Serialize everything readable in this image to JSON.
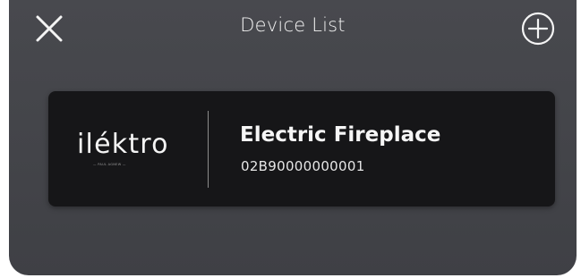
{
  "header": {
    "title": "Device List"
  },
  "devices": [
    {
      "brand": "ilék",
      "brand_suffix": "tro",
      "brand_tagline": "— PAUL AGNEW —",
      "name": "Electric Fireplace",
      "id": "02B90000000001"
    }
  ],
  "icons": {
    "close": "close-icon",
    "add": "plus-circle-icon"
  },
  "colors": {
    "background": "#45464b",
    "card": "#161618",
    "text": "#f4f4f4"
  }
}
